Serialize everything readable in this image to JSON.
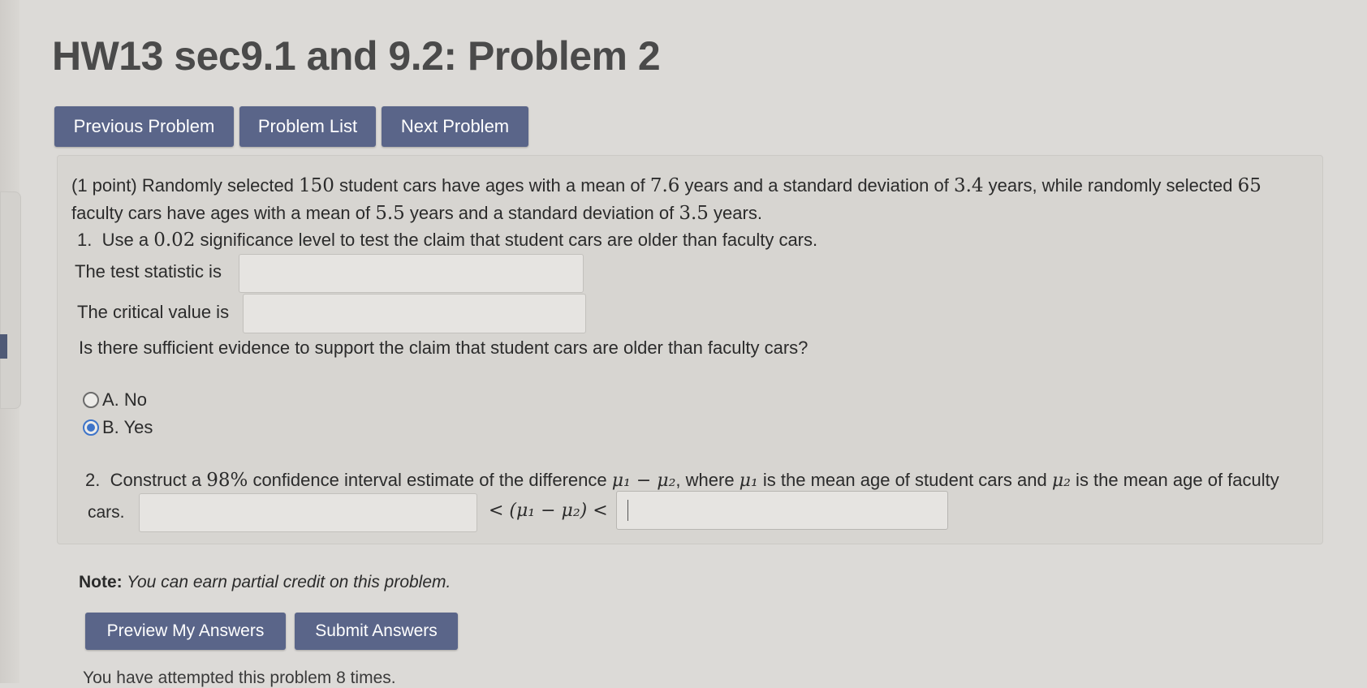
{
  "title": "HW13 sec9.1 and 9.2: Problem 2",
  "nav": {
    "previous": "Previous Problem",
    "list": "Problem List",
    "next": "Next Problem"
  },
  "problem": {
    "line1_a": "(1 point) Randomly selected ",
    "n1": "150",
    "line1_b": " student cars have ages with a mean of ",
    "mean1": "7.6",
    "line1_c": " years and a standard deviation of ",
    "sd1": "3.4",
    "line1_d": " years, while randomly selected ",
    "n2": "65",
    "line2_a": "faculty cars have ages with a mean of ",
    "mean2": "5.5",
    "line2_b": " years and a standard deviation of ",
    "sd2": "3.5",
    "line2_c": " years.",
    "part1_num": "1.",
    "part1_a": "Use a ",
    "alpha": "0.02",
    "part1_b": " significance level to test the claim that student cars are older than faculty cars.",
    "test_stat_label": "The test statistic is",
    "test_stat_value": "",
    "critical_label": "The critical value is",
    "critical_value": "",
    "question": "Is there sufficient evidence to support the claim that student cars are older than faculty cars?",
    "option_a_letter": "A.",
    "option_a_text": " No",
    "option_b_letter": "B.",
    "option_b_text": " Yes",
    "selected_option": "B",
    "part2_num": "2.",
    "part2_a": "Construct a ",
    "conf": "98%",
    "part2_b": " confidence interval estimate of the difference ",
    "mu_diff": "μ₁ − μ₂",
    "part2_c": ", where ",
    "mu1": "μ₁",
    "part2_d": " is the mean age of student cars and ",
    "mu2": "μ₂",
    "part2_e": " is the mean age of faculty",
    "part2_cont": "cars.",
    "interval_middle": "< (μ₁ − μ₂) <",
    "lower_bound": "",
    "upper_bound": ""
  },
  "note_label": "Note:",
  "note_text": " You can earn partial credit on this problem.",
  "buttons": {
    "preview": "Preview My Answers",
    "submit": "Submit Answers"
  },
  "attempts_text": "You have attempted this problem 8 times."
}
